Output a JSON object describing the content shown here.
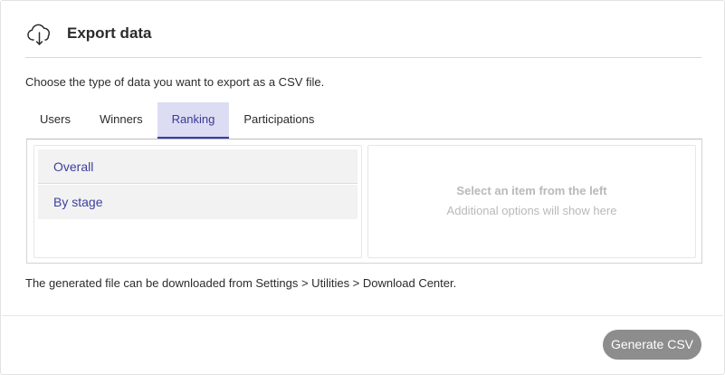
{
  "dialog": {
    "title": "Export data",
    "icon": "cloud-download-icon",
    "description": "Choose the type of data you want to export as a CSV file."
  },
  "tabs": [
    {
      "label": "Users",
      "active": false
    },
    {
      "label": "Winners",
      "active": false
    },
    {
      "label": "Ranking",
      "active": true
    },
    {
      "label": "Participations",
      "active": false
    }
  ],
  "list": {
    "items": [
      {
        "label": "Overall"
      },
      {
        "label": "By stage"
      }
    ]
  },
  "detail": {
    "title": "Select an item from the left",
    "subtitle": "Additional options will show here"
  },
  "footnote": "The generated file can be downloaded from Settings > Utilities > Download Center.",
  "footer": {
    "generate_label": "Generate CSV"
  },
  "colors": {
    "accent": "#3a3da7",
    "active_tab_bg": "#dcdcf3",
    "button_disabled": "#8d8d8d"
  }
}
